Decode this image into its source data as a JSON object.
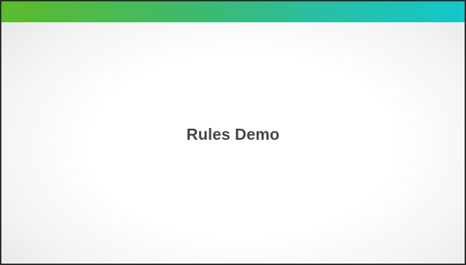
{
  "slide": {
    "title": "Rules Demo"
  },
  "theme": {
    "header_gradient": [
      "#5cbb2b",
      "#3fb96b",
      "#27bfa4",
      "#13c7c9"
    ],
    "title_color": "#474747",
    "border_color": "#2b2b2b"
  }
}
